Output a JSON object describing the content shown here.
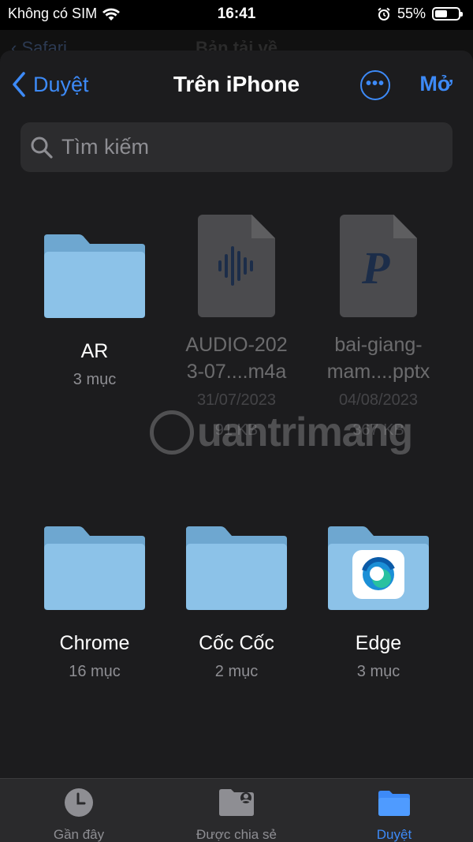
{
  "status_bar": {
    "carrier": "Không có SIM",
    "time": "16:41",
    "battery_percent": "55%",
    "battery_level": 0.55
  },
  "behind": {
    "back_label": "Safari",
    "title": "Bản tải về"
  },
  "nav": {
    "back_label": "Duyệt",
    "title": "Trên iPhone",
    "open_label": "Mở"
  },
  "search": {
    "placeholder": "Tìm kiếm"
  },
  "items": [
    {
      "name": "AR",
      "sub": "3 mục"
    },
    {
      "name_line1": "AUDIO-202",
      "name_line2": "3-07....m4a",
      "date": "31/07/2023",
      "size": "91 KB"
    },
    {
      "name_line1": "bai-giang-",
      "name_line2": "mam....pptx",
      "date": "04/08/2023",
      "size": "367 KB"
    },
    {
      "name": "Chrome",
      "sub": "16 mục"
    },
    {
      "name": "Cốc Cốc",
      "sub": "2 mục"
    },
    {
      "name": "Edge",
      "sub": "3 mục"
    }
  ],
  "tabs": [
    {
      "label": "Gần đây"
    },
    {
      "label": "Được chia sẻ"
    },
    {
      "label": "Duyệt",
      "active": true
    }
  ],
  "watermark": {
    "text": "uantrimang"
  },
  "colors": {
    "accent": "#3d8af7",
    "folder": "#8cc2e8",
    "sheet": "#1c1c1e"
  }
}
